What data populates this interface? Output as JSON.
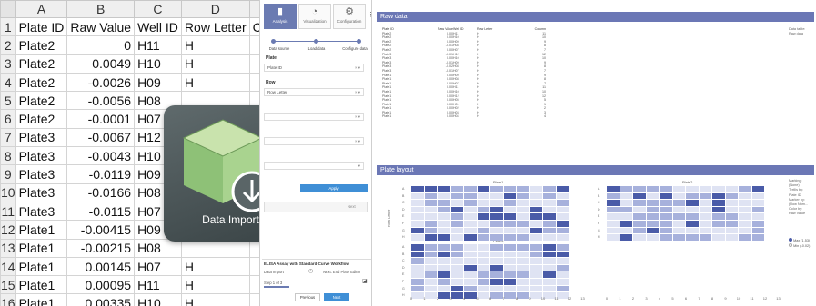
{
  "spreadsheet": {
    "column_letters": [
      "A",
      "B",
      "C",
      "D"
    ],
    "headers": [
      "Plate ID",
      "Raw Value",
      "Well ID",
      "Row Letter",
      "Co"
    ],
    "row_numbers": [
      "1",
      "2",
      "3",
      "4",
      "5",
      "6",
      "7",
      "8",
      "9",
      "10",
      "11",
      "12",
      "13",
      "14",
      "15",
      "16"
    ],
    "rows": [
      [
        "Plate2",
        "0",
        "H11",
        "H"
      ],
      [
        "Plate2",
        "0.0049",
        "H10",
        "H"
      ],
      [
        "Plate2",
        "-0.0026",
        "H09",
        "H"
      ],
      [
        "Plate2",
        "-0.0056",
        "H08",
        ""
      ],
      [
        "Plate2",
        "-0.0001",
        "H07",
        ""
      ],
      [
        "Plate3",
        "-0.0067",
        "H12",
        ""
      ],
      [
        "Plate3",
        "-0.0043",
        "H10",
        ""
      ],
      [
        "Plate3",
        "-0.0119",
        "H09",
        ""
      ],
      [
        "Plate3",
        "-0.0166",
        "H08",
        ""
      ],
      [
        "Plate3",
        "-0.0115",
        "H07",
        ""
      ],
      [
        "Plate1",
        "-0.00415",
        "H09",
        ""
      ],
      [
        "Plate1",
        "-0.00215",
        "H08",
        ""
      ],
      [
        "Plate1",
        "0.00145",
        "H07",
        "H"
      ],
      [
        "Plate1",
        "0.00095",
        "H11",
        "H"
      ],
      [
        "Plate1",
        "0.00335",
        "H10",
        "H"
      ]
    ]
  },
  "tile": {
    "label": "Data Import"
  },
  "panel": {
    "tabs": [
      "Analysis",
      "Visualization",
      "Configuration"
    ],
    "steps": [
      "Data source",
      "Load data",
      "Configure data"
    ],
    "labels": {
      "plate": "Plate",
      "row": "Row"
    },
    "dropdowns": {
      "plate_id": "Plate ID",
      "row_letter": "Row Letter"
    },
    "apply": "Apply",
    "next_small": "Next",
    "workflow_title": "ELISA Assay with Standard Curve Workflow",
    "data_import": "Data Import",
    "next_step": "Next: End Plate Editor",
    "step_counter": "Step 1 of 3",
    "previous": "Previous",
    "next": "Next"
  },
  "raw_data": {
    "title": "Raw data",
    "side_notes": [
      "Data table:",
      "Raw data"
    ],
    "columns": [
      "Plate ID",
      "Raw Value",
      "Well ID",
      "Row Letter",
      "Column"
    ],
    "rows": [
      [
        "Plate2",
        "0.00",
        "H11",
        "H",
        "11"
      ],
      [
        "Plate2",
        "0.00",
        "H10",
        "H",
        "10"
      ],
      [
        "Plate2",
        "0.00",
        "H09",
        "H",
        "9"
      ],
      [
        "Plate2",
        "-0.01",
        "H08",
        "H",
        "8"
      ],
      [
        "Plate2",
        "0.00",
        "H07",
        "H",
        "7"
      ],
      [
        "Plate3",
        "-0.01",
        "H12",
        "H",
        "12"
      ],
      [
        "Plate3",
        "0.00",
        "H10",
        "H",
        "10"
      ],
      [
        "Plate3",
        "-0.01",
        "H09",
        "H",
        "9"
      ],
      [
        "Plate3",
        "-0.02",
        "H08",
        "H",
        "8"
      ],
      [
        "Plate3",
        "-0.01",
        "H07",
        "H",
        "7"
      ],
      [
        "Plate1",
        "0.00",
        "H09",
        "H",
        "9"
      ],
      [
        "Plate1",
        "0.00",
        "H08",
        "H",
        "8"
      ],
      [
        "Plate1",
        "0.00",
        "H07",
        "H",
        "7"
      ],
      [
        "Plate1",
        "0.00",
        "H11",
        "H",
        "11"
      ],
      [
        "Plate1",
        "0.00",
        "H10",
        "H",
        "10"
      ],
      [
        "Plate1",
        "0.00",
        "H12",
        "H",
        "12"
      ],
      [
        "Plate1",
        "0.00",
        "H05",
        "H",
        "5"
      ],
      [
        "Plate1",
        "0.00",
        "H01",
        "H",
        "1"
      ],
      [
        "Plate1",
        "0.00",
        "H02",
        "H",
        "2"
      ],
      [
        "Plate1",
        "0.00",
        "H03",
        "H",
        "3"
      ],
      [
        "Plate1",
        "0.00",
        "H04",
        "H",
        "4"
      ]
    ]
  },
  "plate_layout": {
    "title": "Plate layout",
    "plate_titles": [
      "Plate1",
      "Plate2",
      "Plate3"
    ],
    "row_letters": [
      "A",
      "B",
      "C",
      "D",
      "E",
      "F",
      "G",
      "H"
    ],
    "y_axis_label": "Row Letter",
    "x_ticks": [
      "0",
      "1",
      "2",
      "3",
      "4",
      "5",
      "6",
      "7",
      "8",
      "9",
      "10",
      "11",
      "12",
      "13"
    ],
    "side_notes": [
      "Marking:",
      "(None)",
      "Trellis by:",
      "Plate ID",
      "Marker by:",
      "(Row Num...",
      "Color by:",
      "Raw Value"
    ],
    "legend": [
      "Max (1.53)",
      "Min (-0.02)"
    ],
    "colors": {
      "high": "#4a5ba8",
      "mid": "#a7b1dc",
      "low": "#dfe3f3"
    }
  }
}
